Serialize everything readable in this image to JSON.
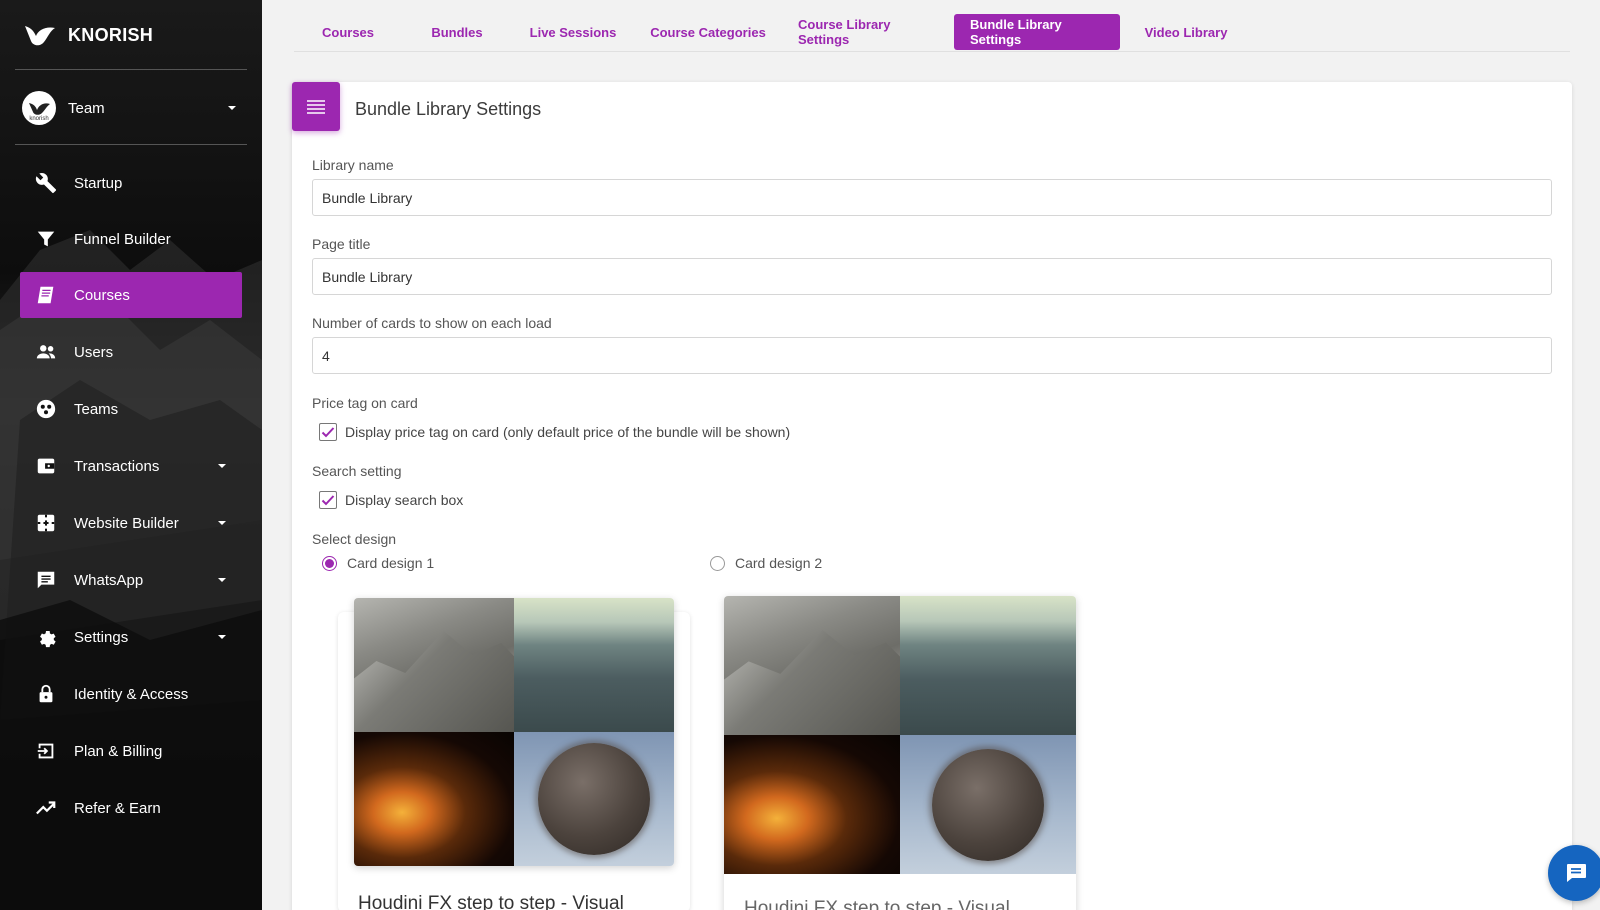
{
  "brand": {
    "name": "KNORISH"
  },
  "team": {
    "label": "Team",
    "avatar_text": "knorish"
  },
  "sidebar": {
    "items": [
      {
        "label": "Startup"
      },
      {
        "label": "Funnel Builder"
      },
      {
        "label": "Courses"
      },
      {
        "label": "Users"
      },
      {
        "label": "Teams"
      },
      {
        "label": "Transactions"
      },
      {
        "label": "Website Builder"
      },
      {
        "label": "WhatsApp"
      },
      {
        "label": "Settings"
      },
      {
        "label": "Identity & Access"
      },
      {
        "label": "Plan & Billing"
      },
      {
        "label": "Refer & Earn"
      }
    ]
  },
  "tabs": [
    {
      "label": "Courses"
    },
    {
      "label": "Bundles"
    },
    {
      "label": "Live Sessions"
    },
    {
      "label": "Course Categories"
    },
    {
      "label": "Course Library Settings"
    },
    {
      "label": "Bundle Library Settings"
    },
    {
      "label": "Video Library"
    }
  ],
  "form": {
    "title": "Bundle Library Settings",
    "library_name": {
      "label": "Library name",
      "value": "Bundle Library"
    },
    "page_title": {
      "label": "Page title",
      "value": "Bundle Library"
    },
    "cards_per_load": {
      "label": "Number of cards to show on each load",
      "value": "4"
    },
    "price_tag": {
      "label": "Price tag on card",
      "checkbox": "Display price tag on card (only default price of the bundle will be shown)",
      "checked": true
    },
    "search": {
      "label": "Search setting",
      "checkbox": "Display search box",
      "checked": true
    },
    "design": {
      "label": "Select design",
      "option1": "Card design 1",
      "option2": "Card design 2",
      "selected": "Card design 1"
    }
  },
  "previews": {
    "card1_title": "Houdini FX step to step - Visual",
    "card2_title": "Houdini FX step to step - Visual"
  },
  "colors": {
    "accent": "#9c27b0",
    "chat": "#1565c0"
  }
}
